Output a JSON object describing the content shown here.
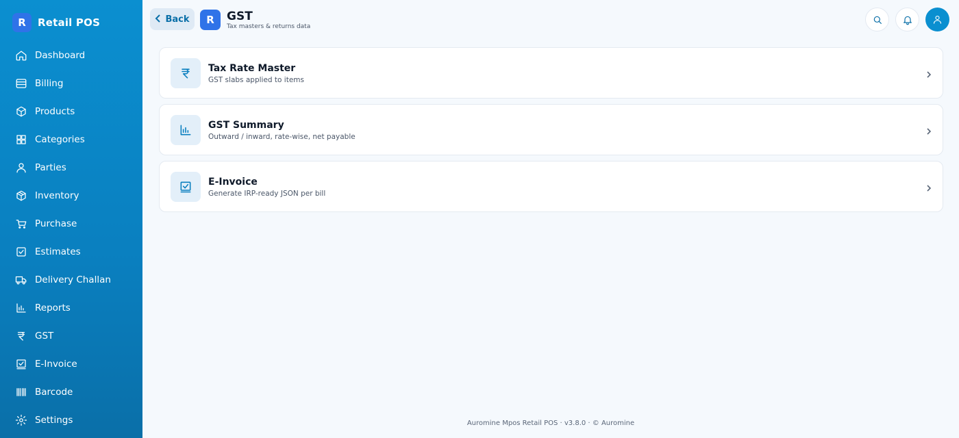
{
  "sidebar": {
    "brand_logo": "R",
    "brand_name": "Retail POS",
    "items": [
      {
        "label": "Dashboard",
        "icon": "home-icon"
      },
      {
        "label": "Billing",
        "icon": "billing-icon"
      },
      {
        "label": "Products",
        "icon": "box-icon"
      },
      {
        "label": "Categories",
        "icon": "grid-icon"
      },
      {
        "label": "Parties",
        "icon": "user-icon"
      },
      {
        "label": "Inventory",
        "icon": "package-icon"
      },
      {
        "label": "Purchase",
        "icon": "cart-icon"
      },
      {
        "label": "Estimates",
        "icon": "checkbox-icon"
      },
      {
        "label": "Delivery Challan",
        "icon": "truck-icon"
      },
      {
        "label": "Reports",
        "icon": "bar-chart-icon"
      },
      {
        "label": "GST",
        "icon": "rupee-icon"
      },
      {
        "label": "E-Invoice",
        "icon": "invoice-check-icon"
      },
      {
        "label": "Barcode",
        "icon": "barcode-icon"
      },
      {
        "label": "Settings",
        "icon": "gear-icon"
      }
    ]
  },
  "header": {
    "back_label": "Back",
    "logo": "R",
    "title": "GST",
    "subtitle": "Tax masters & returns data"
  },
  "cards": [
    {
      "title": "Tax Rate Master",
      "desc": "GST slabs applied to items",
      "icon": "rupee-icon"
    },
    {
      "title": "GST Summary",
      "desc": "Outward / inward, rate-wise, net payable",
      "icon": "bar-chart-icon"
    },
    {
      "title": "E-Invoice",
      "desc": "Generate IRP-ready JSON per bill",
      "icon": "invoice-check-icon"
    }
  ],
  "footer": "Auromine Mpos Retail POS · v3.8.0 · © Auromine",
  "colors": {
    "sidebar": "#0b8fd0",
    "accent": "#0a7fbf",
    "logo": "#2f73e8",
    "background": "#f5f9fd"
  }
}
